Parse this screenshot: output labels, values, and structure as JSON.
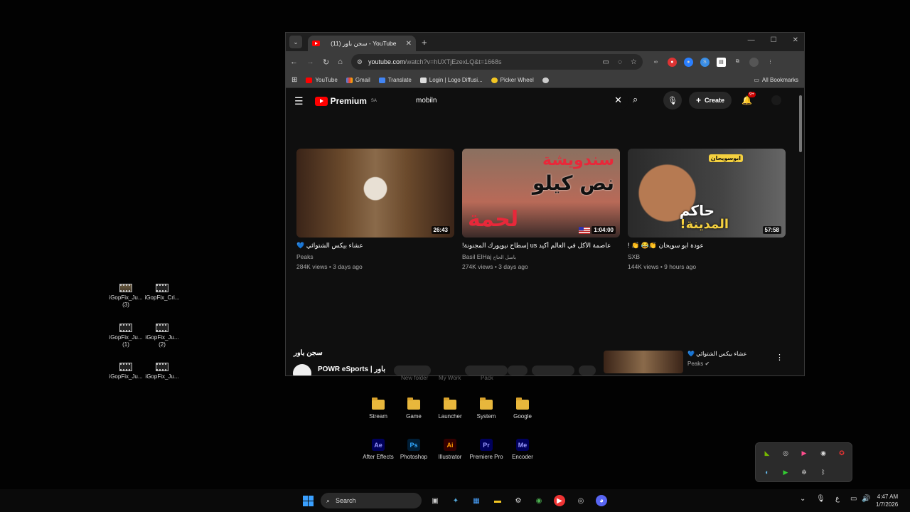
{
  "desktop_icons": [
    {
      "label": "iGopFix_Ju...",
      "sub": "(3)"
    },
    {
      "label": "iGopFix_Cri...",
      "sub": ""
    },
    {
      "label": "iGopFix_Ju...",
      "sub": "(1)"
    },
    {
      "label": "iGopFix_Ju...",
      "sub": "(2)"
    },
    {
      "label": "iGopFix_Ju...",
      "sub": ""
    },
    {
      "label": "iGopFix_Ju...",
      "sub": ""
    }
  ],
  "browser": {
    "tab_title": "(11) سجن باور - YouTube",
    "url_host": "youtube.com",
    "url_path": "/watch?v=hUXTjEzexLQ&t=1668s",
    "bookmarks": [
      "YouTube",
      "Gmail",
      "Translate",
      "Login | Logo Diffusi...",
      "Picker Wheel"
    ],
    "all_bookmarks": "All Bookmarks"
  },
  "youtube": {
    "logo_text": "Premium",
    "region": "SA",
    "search_value": "mobiln",
    "create_label": "Create",
    "notification_count": "9+",
    "videos": [
      {
        "title": "عشاء بيكس الشتوائي 💙",
        "channel": "Peaks",
        "meta": "284K views • 3 days ago",
        "duration": "26:43"
      },
      {
        "title": "عاصمة الأكل في العالم أكيد us إسطاح نيويورك المجنونة!",
        "channel": "Basil ElHaj",
        "channel_extra": "باسل الحاج",
        "meta": "274K views • 3 days ago",
        "duration": "1:04:00",
        "thumb_text_1": "سندويشة",
        "thumb_text_2": "نص كيلو",
        "thumb_text_3": "لحمة"
      },
      {
        "title": "عودة ابو سويحان 👏😂 👏 !",
        "channel": "SXB",
        "meta": "144K views • 9 hours ago",
        "duration": "57:58",
        "thumb_text_1": "حاكم",
        "thumb_text_2": "المدينة!",
        "thumb_tag": "ابوسويحان"
      }
    ],
    "now_playing": {
      "title": "سجن باور",
      "channel": "POWR eSports | باور"
    },
    "up_next": {
      "title": "عشاء بيكس الشتوائي 💙",
      "channel": "Peaks"
    }
  },
  "ghost_labels": [
    "New folder",
    "My Work",
    "Pack"
  ],
  "folders": [
    "Stream",
    "Game",
    "Launcher",
    "System",
    "Google"
  ],
  "apps": [
    {
      "abbr": "Ae",
      "label": "After Effects",
      "color": "#9999ff",
      "bg": "#00005b"
    },
    {
      "abbr": "Ps",
      "label": "Photoshop",
      "color": "#31a8ff",
      "bg": "#001e36"
    },
    {
      "abbr": "Ai",
      "label": "Illustrator",
      "color": "#ff9a00",
      "bg": "#330000"
    },
    {
      "abbr": "Pr",
      "label": "Premiere Pro",
      "color": "#9999ff",
      "bg": "#00005b"
    },
    {
      "abbr": "Me",
      "label": "Encoder",
      "color": "#9999ff",
      "bg": "#00005b"
    }
  ],
  "taskbar": {
    "search_placeholder": "Search",
    "lang": "ع",
    "time": "4:47 AM",
    "date": "1/7/2026"
  }
}
